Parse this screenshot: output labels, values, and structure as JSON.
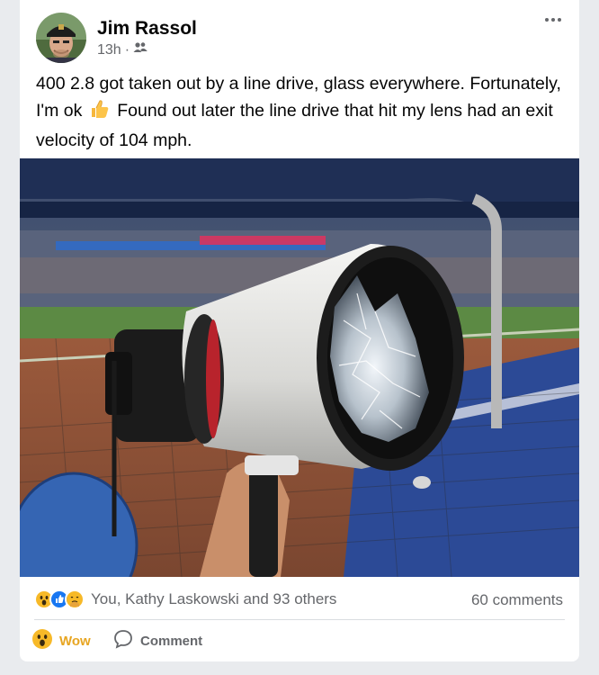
{
  "post": {
    "author": "Jim Rassol",
    "time": "13h",
    "separator": "·",
    "audience_icon": "friends-icon",
    "text_before_emoji": "400 2.8 got taken out by a line drive, glass everywhere. Fortunately, I'm ok",
    "emoji": "thumbs-up-icon",
    "text_after_emoji": "Found out later the line drive that hit my lens had an exit velocity of 104 mph.",
    "photo_icon": "broken-lens-photo"
  },
  "reactions": {
    "icons": [
      "wow-emoji-icon",
      "like-emoji-icon",
      "care-emoji-icon"
    ],
    "summary": "You, Kathy Laskowski and 93 others",
    "comments": "60 comments"
  },
  "actions": {
    "wow_label": "Wow",
    "comment_label": "Comment"
  },
  "colors": {
    "wow_accent": "#e7a521",
    "like_blue": "#1877f2",
    "muted_text": "#65676b"
  }
}
